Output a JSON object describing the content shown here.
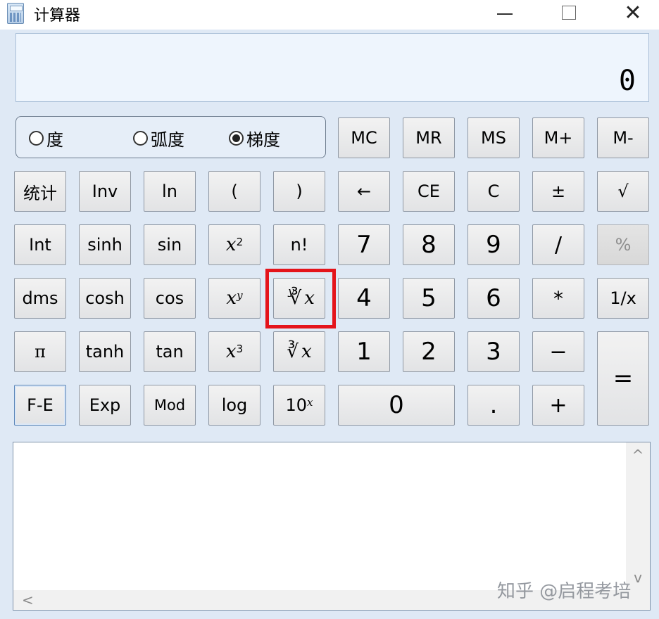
{
  "window": {
    "title": "计算器",
    "icon": "calculator-icon",
    "minimize_icon": "minimize-icon",
    "maximize_icon": "maximize-icon",
    "close_label": "✕"
  },
  "display": {
    "value": "0"
  },
  "angle_units": {
    "degree": "度",
    "radian": "弧度",
    "gradian": "梯度",
    "selected": "gradian"
  },
  "memory": {
    "mc": "MC",
    "mr": "MR",
    "ms": "MS",
    "mplus": "M+",
    "mminus": "M-"
  },
  "buttons": {
    "stats": "统计",
    "inv": "Inv",
    "ln": "ln",
    "lparen": "(",
    "rparen": ")",
    "backspace": "←",
    "ce": "CE",
    "c": "C",
    "negate": "±",
    "sqrt": "√",
    "int": "Int",
    "sinh": "sinh",
    "sin": "sin",
    "x_base": "x",
    "x_sq_exp": "2",
    "factorial": "n!",
    "seven": "7",
    "eight": "8",
    "nine": "9",
    "divide": "/",
    "percent": "%",
    "dms": "dms",
    "cosh": "cosh",
    "cos": "cos",
    "xy_exp": "y",
    "yroot_index": "y",
    "root_symbol": "∛",
    "four": "4",
    "five": "5",
    "six": "6",
    "multiply": "*",
    "reciprocal": "1/x",
    "pi": "π",
    "tanh": "tanh",
    "tan": "tan",
    "x_cube_exp": "3",
    "cube_root_symbol": "∛",
    "one": "1",
    "two": "2",
    "three": "3",
    "subtract": "−",
    "equals": "=",
    "fe": "F-E",
    "exp": "Exp",
    "mod": "Mod",
    "log": "log",
    "ten_base": "10",
    "ten_exp": "x",
    "zero": "0",
    "decimal": ".",
    "add": "+"
  },
  "history": {
    "scroll_up": "^",
    "scroll_down": "v",
    "scroll_left": "<"
  },
  "watermark": "知乎 @启程考培",
  "colors": {
    "highlight": "#e4141b",
    "display_bg": "#eef5fd",
    "window_bg": "#dfe9f5"
  }
}
